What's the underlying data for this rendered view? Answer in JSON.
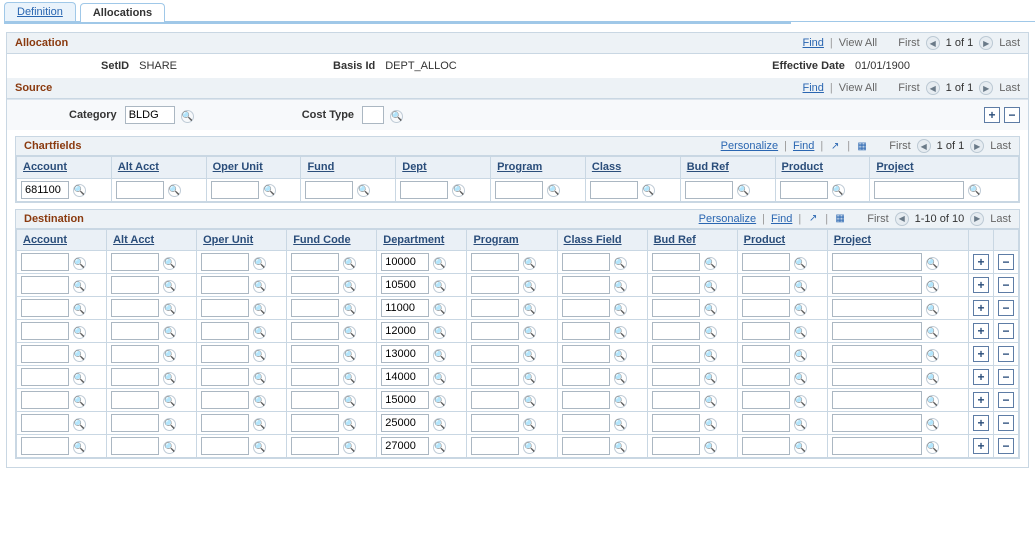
{
  "tabs": {
    "definition": "Definition",
    "allocations": "Allocations"
  },
  "nav": {
    "find": "Find",
    "view_all": "View All",
    "first": "First",
    "last": "Last",
    "personalize": "Personalize"
  },
  "allocation": {
    "title": "Allocation",
    "page_info": "1 of 1",
    "setid_label": "SetID",
    "setid_value": "SHARE",
    "basisid_label": "Basis Id",
    "basisid_value": "DEPT_ALLOC",
    "effdate_label": "Effective Date",
    "effdate_value": "01/01/1900"
  },
  "source": {
    "title": "Source",
    "page_info": "1 of 1",
    "category_label": "Category",
    "category_value": "BLDG",
    "costtype_label": "Cost Type",
    "costtype_value": ""
  },
  "chartfields": {
    "title": "Chartfields",
    "page_info": "1 of 1",
    "columns": [
      "Account",
      "Alt Acct",
      "Oper Unit",
      "Fund",
      "Dept",
      "Program",
      "Class",
      "Bud Ref",
      "Product",
      "Project"
    ],
    "row": {
      "account": "681100",
      "alt_acct": "",
      "oper_unit": "",
      "fund": "",
      "dept": "",
      "program": "",
      "class": "",
      "bud_ref": "",
      "product": "",
      "project": ""
    }
  },
  "destination": {
    "title": "Destination",
    "page_info": "1-10 of 10",
    "columns": [
      "Account",
      "Alt Acct",
      "Oper Unit",
      "Fund Code",
      "Department",
      "Program",
      "Class Field",
      "Bud Ref",
      "Product",
      "Project"
    ],
    "rows": [
      {
        "account": "",
        "alt_acct": "",
        "oper_unit": "",
        "fund": "",
        "dept": "10000",
        "program": "",
        "class": "",
        "bud_ref": "",
        "product": "",
        "project": ""
      },
      {
        "account": "",
        "alt_acct": "",
        "oper_unit": "",
        "fund": "",
        "dept": "10500",
        "program": "",
        "class": "",
        "bud_ref": "",
        "product": "",
        "project": ""
      },
      {
        "account": "",
        "alt_acct": "",
        "oper_unit": "",
        "fund": "",
        "dept": "11000",
        "program": "",
        "class": "",
        "bud_ref": "",
        "product": "",
        "project": ""
      },
      {
        "account": "",
        "alt_acct": "",
        "oper_unit": "",
        "fund": "",
        "dept": "12000",
        "program": "",
        "class": "",
        "bud_ref": "",
        "product": "",
        "project": ""
      },
      {
        "account": "",
        "alt_acct": "",
        "oper_unit": "",
        "fund": "",
        "dept": "13000",
        "program": "",
        "class": "",
        "bud_ref": "",
        "product": "",
        "project": ""
      },
      {
        "account": "",
        "alt_acct": "",
        "oper_unit": "",
        "fund": "",
        "dept": "14000",
        "program": "",
        "class": "",
        "bud_ref": "",
        "product": "",
        "project": ""
      },
      {
        "account": "",
        "alt_acct": "",
        "oper_unit": "",
        "fund": "",
        "dept": "15000",
        "program": "",
        "class": "",
        "bud_ref": "",
        "product": "",
        "project": ""
      },
      {
        "account": "",
        "alt_acct": "",
        "oper_unit": "",
        "fund": "",
        "dept": "25000",
        "program": "",
        "class": "",
        "bud_ref": "",
        "product": "",
        "project": ""
      },
      {
        "account": "",
        "alt_acct": "",
        "oper_unit": "",
        "fund": "",
        "dept": "27000",
        "program": "",
        "class": "",
        "bud_ref": "",
        "product": "",
        "project": ""
      }
    ]
  }
}
